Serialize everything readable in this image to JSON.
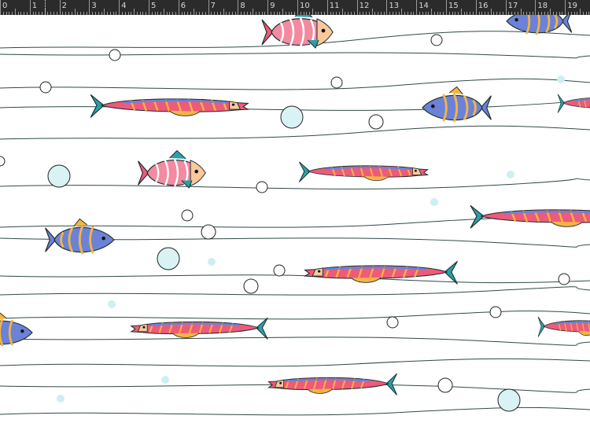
{
  "ruler": {
    "unit_labels": [
      "0",
      "1",
      "2",
      "3",
      "4",
      "5",
      "6",
      "7",
      "8",
      "9",
      "10",
      "11",
      "12",
      "13",
      "14",
      "15",
      "16",
      "17",
      "18",
      "19"
    ]
  },
  "artwork": {
    "theme": "striped fish swimming among wavy lines and bubbles",
    "colors": {
      "line": "#2f4a48",
      "bubble_outline": "#222222",
      "bubble_fill": "#d9f2f4",
      "bubble_faint": "#cdeff3",
      "pink": "#ef5a7a",
      "blue": "#6b82d6",
      "orange": "#f5b443",
      "teal": "#2aa0a8",
      "peach": "#f7c99b"
    }
  }
}
